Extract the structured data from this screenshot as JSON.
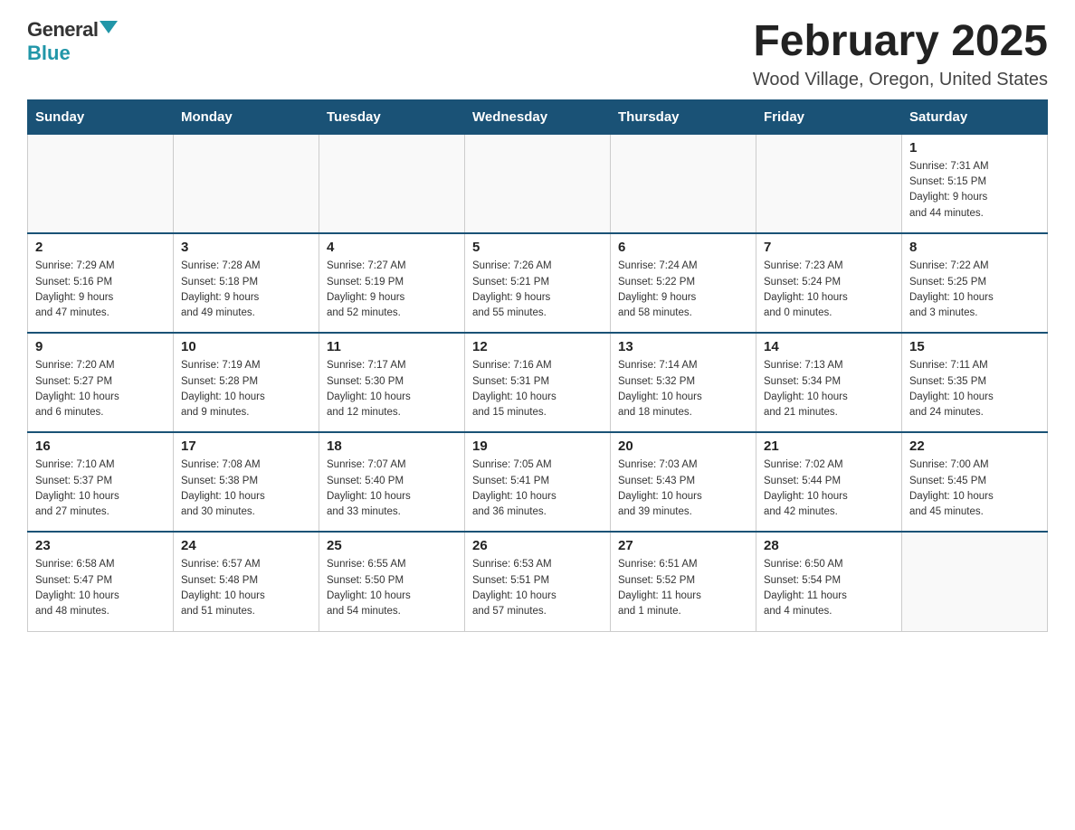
{
  "logo": {
    "general": "General",
    "blue": "Blue"
  },
  "title": "February 2025",
  "subtitle": "Wood Village, Oregon, United States",
  "days_of_week": [
    "Sunday",
    "Monday",
    "Tuesday",
    "Wednesday",
    "Thursday",
    "Friday",
    "Saturday"
  ],
  "weeks": [
    [
      {
        "day": "",
        "info": ""
      },
      {
        "day": "",
        "info": ""
      },
      {
        "day": "",
        "info": ""
      },
      {
        "day": "",
        "info": ""
      },
      {
        "day": "",
        "info": ""
      },
      {
        "day": "",
        "info": ""
      },
      {
        "day": "1",
        "info": "Sunrise: 7:31 AM\nSunset: 5:15 PM\nDaylight: 9 hours\nand 44 minutes."
      }
    ],
    [
      {
        "day": "2",
        "info": "Sunrise: 7:29 AM\nSunset: 5:16 PM\nDaylight: 9 hours\nand 47 minutes."
      },
      {
        "day": "3",
        "info": "Sunrise: 7:28 AM\nSunset: 5:18 PM\nDaylight: 9 hours\nand 49 minutes."
      },
      {
        "day": "4",
        "info": "Sunrise: 7:27 AM\nSunset: 5:19 PM\nDaylight: 9 hours\nand 52 minutes."
      },
      {
        "day": "5",
        "info": "Sunrise: 7:26 AM\nSunset: 5:21 PM\nDaylight: 9 hours\nand 55 minutes."
      },
      {
        "day": "6",
        "info": "Sunrise: 7:24 AM\nSunset: 5:22 PM\nDaylight: 9 hours\nand 58 minutes."
      },
      {
        "day": "7",
        "info": "Sunrise: 7:23 AM\nSunset: 5:24 PM\nDaylight: 10 hours\nand 0 minutes."
      },
      {
        "day": "8",
        "info": "Sunrise: 7:22 AM\nSunset: 5:25 PM\nDaylight: 10 hours\nand 3 minutes."
      }
    ],
    [
      {
        "day": "9",
        "info": "Sunrise: 7:20 AM\nSunset: 5:27 PM\nDaylight: 10 hours\nand 6 minutes."
      },
      {
        "day": "10",
        "info": "Sunrise: 7:19 AM\nSunset: 5:28 PM\nDaylight: 10 hours\nand 9 minutes."
      },
      {
        "day": "11",
        "info": "Sunrise: 7:17 AM\nSunset: 5:30 PM\nDaylight: 10 hours\nand 12 minutes."
      },
      {
        "day": "12",
        "info": "Sunrise: 7:16 AM\nSunset: 5:31 PM\nDaylight: 10 hours\nand 15 minutes."
      },
      {
        "day": "13",
        "info": "Sunrise: 7:14 AM\nSunset: 5:32 PM\nDaylight: 10 hours\nand 18 minutes."
      },
      {
        "day": "14",
        "info": "Sunrise: 7:13 AM\nSunset: 5:34 PM\nDaylight: 10 hours\nand 21 minutes."
      },
      {
        "day": "15",
        "info": "Sunrise: 7:11 AM\nSunset: 5:35 PM\nDaylight: 10 hours\nand 24 minutes."
      }
    ],
    [
      {
        "day": "16",
        "info": "Sunrise: 7:10 AM\nSunset: 5:37 PM\nDaylight: 10 hours\nand 27 minutes."
      },
      {
        "day": "17",
        "info": "Sunrise: 7:08 AM\nSunset: 5:38 PM\nDaylight: 10 hours\nand 30 minutes."
      },
      {
        "day": "18",
        "info": "Sunrise: 7:07 AM\nSunset: 5:40 PM\nDaylight: 10 hours\nand 33 minutes."
      },
      {
        "day": "19",
        "info": "Sunrise: 7:05 AM\nSunset: 5:41 PM\nDaylight: 10 hours\nand 36 minutes."
      },
      {
        "day": "20",
        "info": "Sunrise: 7:03 AM\nSunset: 5:43 PM\nDaylight: 10 hours\nand 39 minutes."
      },
      {
        "day": "21",
        "info": "Sunrise: 7:02 AM\nSunset: 5:44 PM\nDaylight: 10 hours\nand 42 minutes."
      },
      {
        "day": "22",
        "info": "Sunrise: 7:00 AM\nSunset: 5:45 PM\nDaylight: 10 hours\nand 45 minutes."
      }
    ],
    [
      {
        "day": "23",
        "info": "Sunrise: 6:58 AM\nSunset: 5:47 PM\nDaylight: 10 hours\nand 48 minutes."
      },
      {
        "day": "24",
        "info": "Sunrise: 6:57 AM\nSunset: 5:48 PM\nDaylight: 10 hours\nand 51 minutes."
      },
      {
        "day": "25",
        "info": "Sunrise: 6:55 AM\nSunset: 5:50 PM\nDaylight: 10 hours\nand 54 minutes."
      },
      {
        "day": "26",
        "info": "Sunrise: 6:53 AM\nSunset: 5:51 PM\nDaylight: 10 hours\nand 57 minutes."
      },
      {
        "day": "27",
        "info": "Sunrise: 6:51 AM\nSunset: 5:52 PM\nDaylight: 11 hours\nand 1 minute."
      },
      {
        "day": "28",
        "info": "Sunrise: 6:50 AM\nSunset: 5:54 PM\nDaylight: 11 hours\nand 4 minutes."
      },
      {
        "day": "",
        "info": ""
      }
    ]
  ]
}
